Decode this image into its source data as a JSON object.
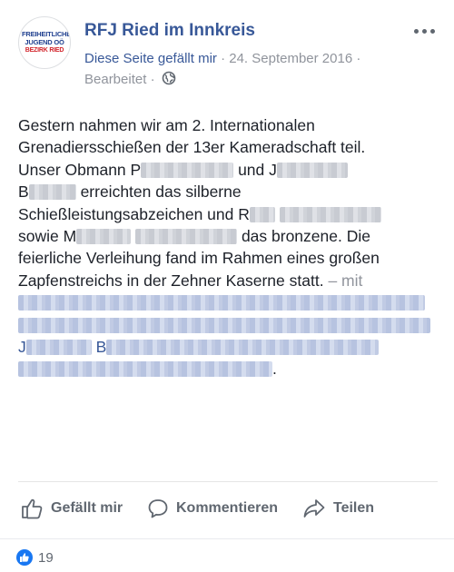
{
  "header": {
    "avatar_lines": [
      "FREIHEITLICHE",
      "JUGEND OÖ",
      "BEZIRK RIED"
    ],
    "page_name": "RFJ Ried im Innkreis",
    "like_status": "Diese Seite gefällt mir",
    "separator": "·",
    "date": "24. September 2016",
    "edited": "Bearbeitet"
  },
  "post": {
    "line1": "Gestern nahmen wir am 2. Internationalen",
    "line2": "Grenadiersschießen der 13er Kameradschaft teil.",
    "line3a": "Unser Obmann P",
    "line3b": "und J",
    "line4a": "B",
    "line4b": "erreichten das silberne",
    "line5a": "Schießleistungsabzeichen und R",
    "line6a": "sowie M",
    "line6b": "das bronzene. Die",
    "line7": "feierliche Verleihung fand im Rahmen eines großen",
    "line8a": "Zapfenstreichs in der Zehner Kaserne statt.",
    "line8b": "– mit",
    "line10a": "J",
    "line10b": "B",
    "line12_end": "."
  },
  "actions": {
    "like": "Gefällt mir",
    "comment": "Kommentieren",
    "share": "Teilen"
  },
  "reactions": {
    "count": "19"
  },
  "colors": {
    "link": "#385898",
    "meta": "#90949c",
    "like_blue": "#1877f2"
  }
}
